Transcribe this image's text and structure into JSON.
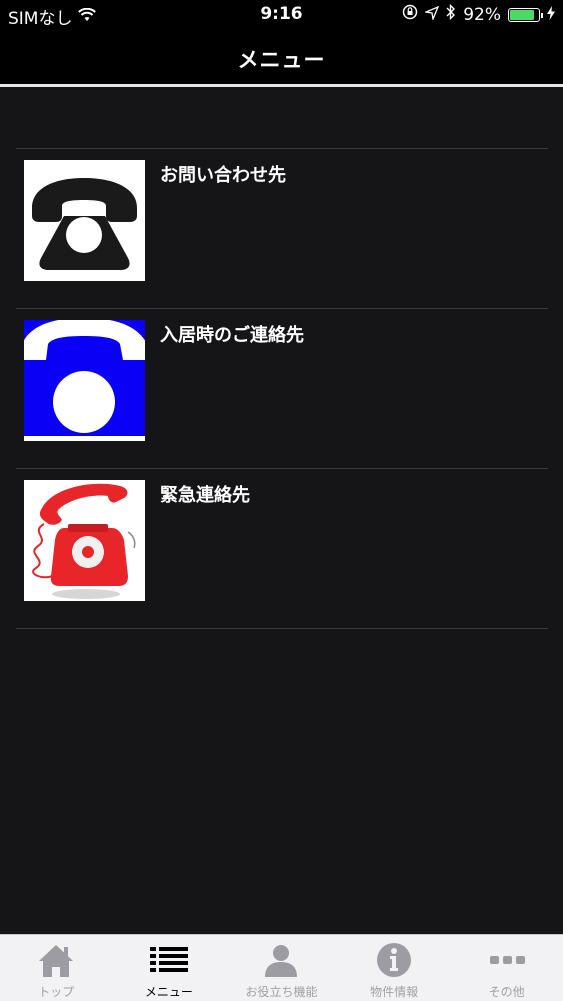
{
  "status_bar": {
    "carrier": "SIMなし",
    "time": "9:16",
    "battery_percent": "92%",
    "battery_level": 0.92,
    "icons": [
      "wifi-icon",
      "rotation-lock-icon",
      "location-icon",
      "bluetooth-icon",
      "battery-icon",
      "charging-icon"
    ]
  },
  "nav": {
    "title": "メニュー"
  },
  "menu": {
    "items": [
      {
        "label": "お問い合わせ先",
        "icon": "black-telephone-icon"
      },
      {
        "label": "入居時のご連絡先",
        "icon": "blue-telephone-icon"
      },
      {
        "label": "緊急連絡先",
        "icon": "red-ringing-telephone-icon"
      }
    ]
  },
  "tabs": {
    "items": [
      {
        "label": "トップ",
        "icon": "home-icon",
        "active": false
      },
      {
        "label": "メニュー",
        "icon": "list-icon",
        "active": true
      },
      {
        "label": "お役立ち機能",
        "icon": "person-icon",
        "active": false
      },
      {
        "label": "物件情報",
        "icon": "info-icon",
        "active": false
      },
      {
        "label": "その他",
        "icon": "more-icon",
        "active": false
      }
    ]
  },
  "colors": {
    "background": "#151517",
    "bar": "#000000",
    "tab_bar": "#f2f2f4",
    "battery": "#4cd964",
    "phone_blue": "#0000ff",
    "phone_red": "#e8262a"
  }
}
